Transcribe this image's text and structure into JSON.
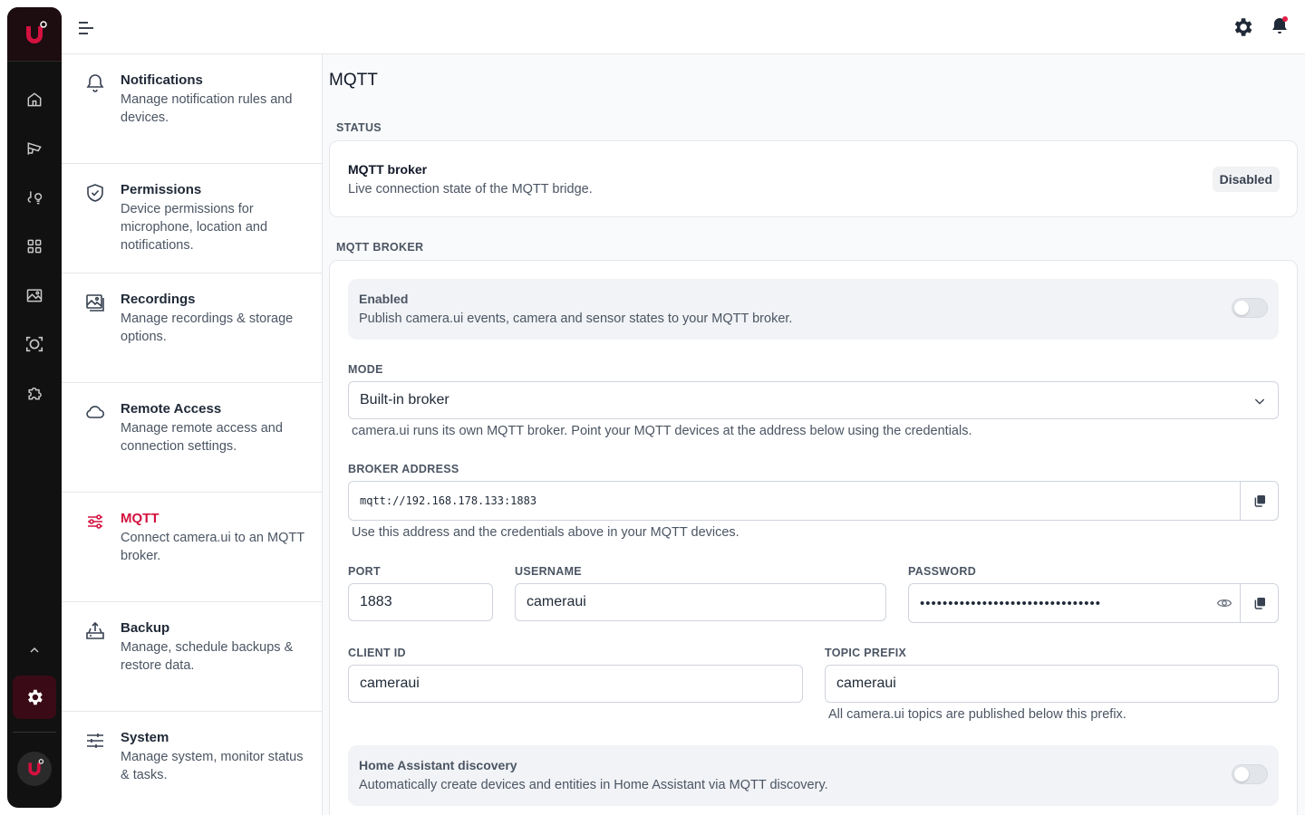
{
  "topbar": {
    "menu_icon": "menu-icon",
    "settings_icon": "gear-icon",
    "notifications_icon": "bell-icon",
    "notification_dot_color": "#e11d48"
  },
  "rail": {
    "brand_color": "#d3113f",
    "items": [
      {
        "name": "home",
        "icon": "home-icon"
      },
      {
        "name": "cameras",
        "icon": "camera-icon"
      },
      {
        "name": "automations",
        "icon": "bulb-icon"
      },
      {
        "name": "dashboard",
        "icon": "grid-icon"
      },
      {
        "name": "gallery",
        "icon": "image-icon"
      },
      {
        "name": "faces",
        "icon": "face-icon"
      },
      {
        "name": "plugins",
        "icon": "puzzle-icon"
      }
    ]
  },
  "settings_nav": [
    {
      "title": "Notifications",
      "desc": "Manage notification rules and devices.",
      "icon": "bell-icon"
    },
    {
      "title": "Permissions",
      "desc": "Device permissions for microphone, location and notifications.",
      "icon": "shield-check-icon"
    },
    {
      "title": "Recordings",
      "desc": "Manage recordings & storage options.",
      "icon": "image-icon"
    },
    {
      "title": "Remote Access",
      "desc": "Manage remote access and connection settings.",
      "icon": "cloud-icon"
    },
    {
      "title": "MQTT",
      "desc": "Connect camera.ui to an MQTT broker.",
      "icon": "mqtt-icon",
      "active": true
    },
    {
      "title": "Backup",
      "desc": "Manage, schedule backups & restore data.",
      "icon": "backup-icon"
    },
    {
      "title": "System",
      "desc": "Manage system, monitor status & tasks.",
      "icon": "sliders-icon"
    }
  ],
  "main": {
    "title": "MQTT",
    "status_section": "STATUS",
    "status": {
      "title": "MQTT broker",
      "desc": "Live connection state of the MQTT bridge.",
      "badge": "Disabled"
    },
    "broker_section": "MQTT BROKER",
    "enabled": {
      "title": "Enabled",
      "desc": "Publish camera.ui events, camera and sensor states to your MQTT broker.",
      "on": false
    },
    "mode": {
      "label": "MODE",
      "value": "Built-in broker",
      "help": "camera.ui runs its own MQTT broker. Point your MQTT devices at the address below using the credentials."
    },
    "broker_address": {
      "label": "BROKER ADDRESS",
      "value": "mqtt://192.168.178.133:1883",
      "help": "Use this address and the credentials above in your MQTT devices."
    },
    "port": {
      "label": "PORT",
      "value": "1883"
    },
    "username": {
      "label": "USERNAME",
      "value": "cameraui"
    },
    "password": {
      "label": "PASSWORD",
      "value": "••••••••••••••••••••••••••••••••"
    },
    "client_id": {
      "label": "CLIENT ID",
      "value": "cameraui"
    },
    "topic_prefix": {
      "label": "TOPIC PREFIX",
      "value": "cameraui",
      "help": "All camera.ui topics are published below this prefix."
    },
    "ha_discovery": {
      "title": "Home Assistant discovery",
      "desc": "Automatically create devices and entities in Home Assistant via MQTT discovery.",
      "on": false
    }
  }
}
